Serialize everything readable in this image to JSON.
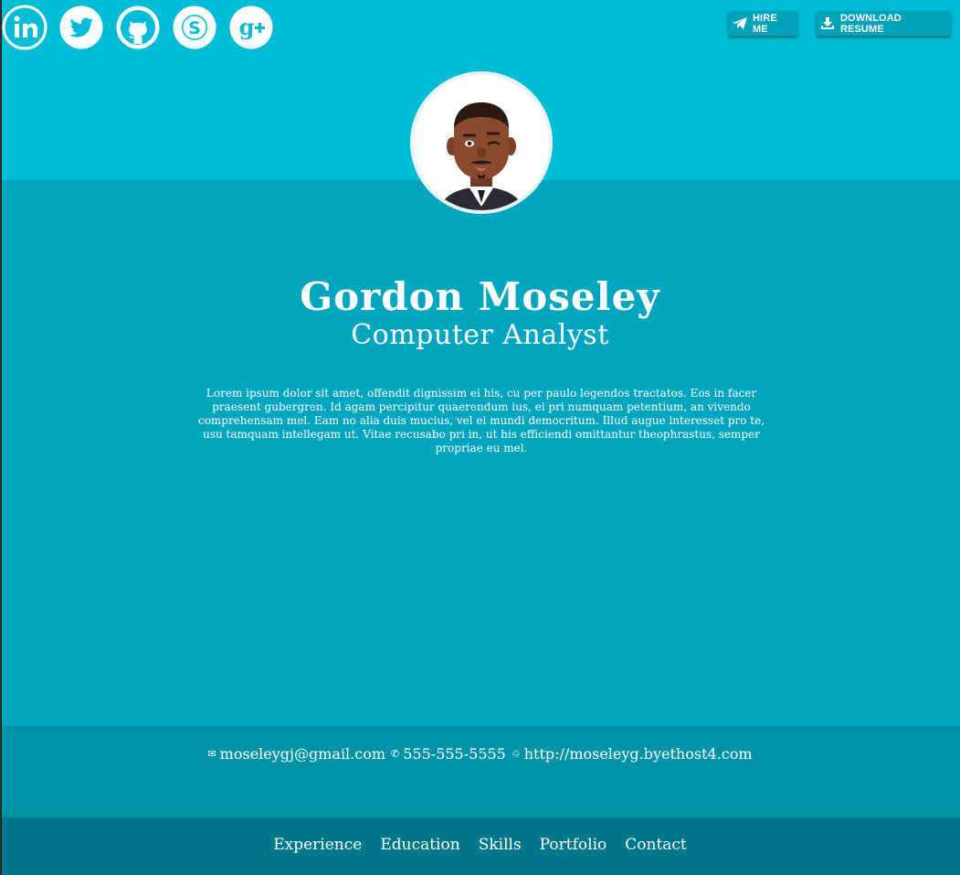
{
  "social": [
    {
      "icon": "linkedin-icon"
    },
    {
      "icon": "twitter-icon"
    },
    {
      "icon": "github-icon"
    },
    {
      "icon": "skype-icon"
    },
    {
      "icon": "google-plus-icon"
    }
  ],
  "actions": {
    "hire_label": "HIRE ME",
    "resume_label": "DOWNLOAD RESUME"
  },
  "profile": {
    "name": "Gordon Moseley",
    "title": "Computer Analyst",
    "bio": "Lorem ipsum dolor sit amet, offendit dignissim ei his, cu per paulo legendos tractatos. Eos in facer praesent gubergren. Id agam percipitur quaerendum ius, ei pri numquam petentium, an vivendo comprehensam mel. Eam no alia duis mucius, vel ei mundi democritum. Illud augue interesset pro te, usu tamquam intellegam ut. Vitae recusabo pri in, ut his efficiendi omittantur theophrastus, semper propriae eu mel."
  },
  "contact": {
    "email": "moseleygj@gmail.com",
    "phone": "555-555-5555",
    "website": "http://moseleyg.byethost4.com"
  },
  "nav": [
    "Experience",
    "Education",
    "Skills",
    "Portfolio",
    "Contact"
  ],
  "colors": {
    "top": "#00bcd4",
    "main": "#00a5bf",
    "contact": "#0092a6",
    "nav": "#00788a"
  }
}
